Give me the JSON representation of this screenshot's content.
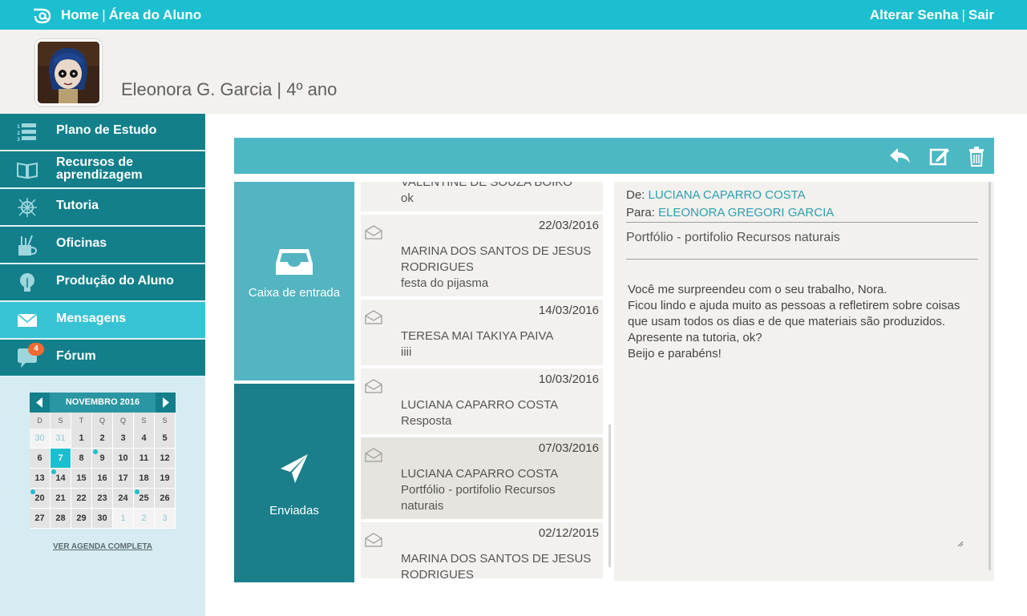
{
  "topbar": {
    "home": "Home",
    "sep": "|",
    "area": "Área do Aluno",
    "change_password": "Alterar Senha",
    "logout": "Sair"
  },
  "profile": {
    "name": "Eleonora G. Garcia | 4º ano"
  },
  "nav": [
    {
      "label": "Plano de Estudo",
      "icon": "list-icon"
    },
    {
      "label": "Recursos de aprendizagem",
      "icon": "book-icon"
    },
    {
      "label": "Tutoria",
      "icon": "compass-icon"
    },
    {
      "label": "Oficinas",
      "icon": "tools-cup-icon"
    },
    {
      "label": "Produção do Aluno",
      "icon": "lightbulb-icon"
    },
    {
      "label": "Mensagens",
      "icon": "envelope-icon"
    },
    {
      "label": "Fórum",
      "icon": "chat-icon",
      "badge": "4"
    }
  ],
  "calendar": {
    "month": "NOVEMBRO 2016",
    "weekdays": [
      "D",
      "S",
      "T",
      "Q",
      "Q",
      "S",
      "S"
    ],
    "days": [
      "30",
      "31",
      "1",
      "2",
      "3",
      "4",
      "5",
      "6",
      "7",
      "8",
      "9",
      "10",
      "11",
      "12",
      "13",
      "14",
      "15",
      "16",
      "17",
      "18",
      "19",
      "20",
      "21",
      "22",
      "23",
      "24",
      "25",
      "26",
      "27",
      "28",
      "29",
      "30",
      "1",
      "2",
      "3"
    ],
    "link": "VER AGENDA COMPLETA"
  },
  "folders": {
    "inbox": "Caixa de entrada",
    "sent": "Enviadas"
  },
  "messages": [
    {
      "date": "",
      "sender": "VALENTINE DE SOUZA BOIKO",
      "subject": "ok"
    },
    {
      "date": "22/03/2016",
      "sender": "MARINA DOS SANTOS DE JESUS RODRIGUES",
      "subject": "festa do pijasma"
    },
    {
      "date": "14/03/2016",
      "sender": "TERESA MAI TAKIYA PAIVA",
      "subject": "iiii"
    },
    {
      "date": "10/03/2016",
      "sender": "LUCIANA CAPARRO COSTA",
      "subject": "Resposta"
    },
    {
      "date": "07/03/2016",
      "sender": "LUCIANA CAPARRO COSTA",
      "subject": "Portfólio - portifolio Recursos naturais"
    },
    {
      "date": "02/12/2015",
      "sender": "MARINA DOS SANTOS DE JESUS RODRIGUES",
      "subject": ""
    }
  ],
  "reader": {
    "from_label": "De:",
    "from": "LUCIANA CAPARRO COSTA",
    "to_label": "Para:",
    "to": "ELEONORA GREGORI GARCIA",
    "subject": "Portfólio - portifolio Recursos naturais",
    "body": [
      "Você me surpreendeu com o seu trabalho, Nora.",
      "Ficou lindo e ajuda muito as pessoas a refletirem sobre coisas que usam todos os dias e de que materiais são produzidos.",
      "Apresente na tutoria, ok?",
      "Beijo e parabéns!"
    ]
  },
  "colors": {
    "topbar": "#1cbfcf",
    "nav": "#127f8b",
    "nav_active": "#38c3d4",
    "link": "#2d9fb0",
    "badge": "#f26b32"
  }
}
